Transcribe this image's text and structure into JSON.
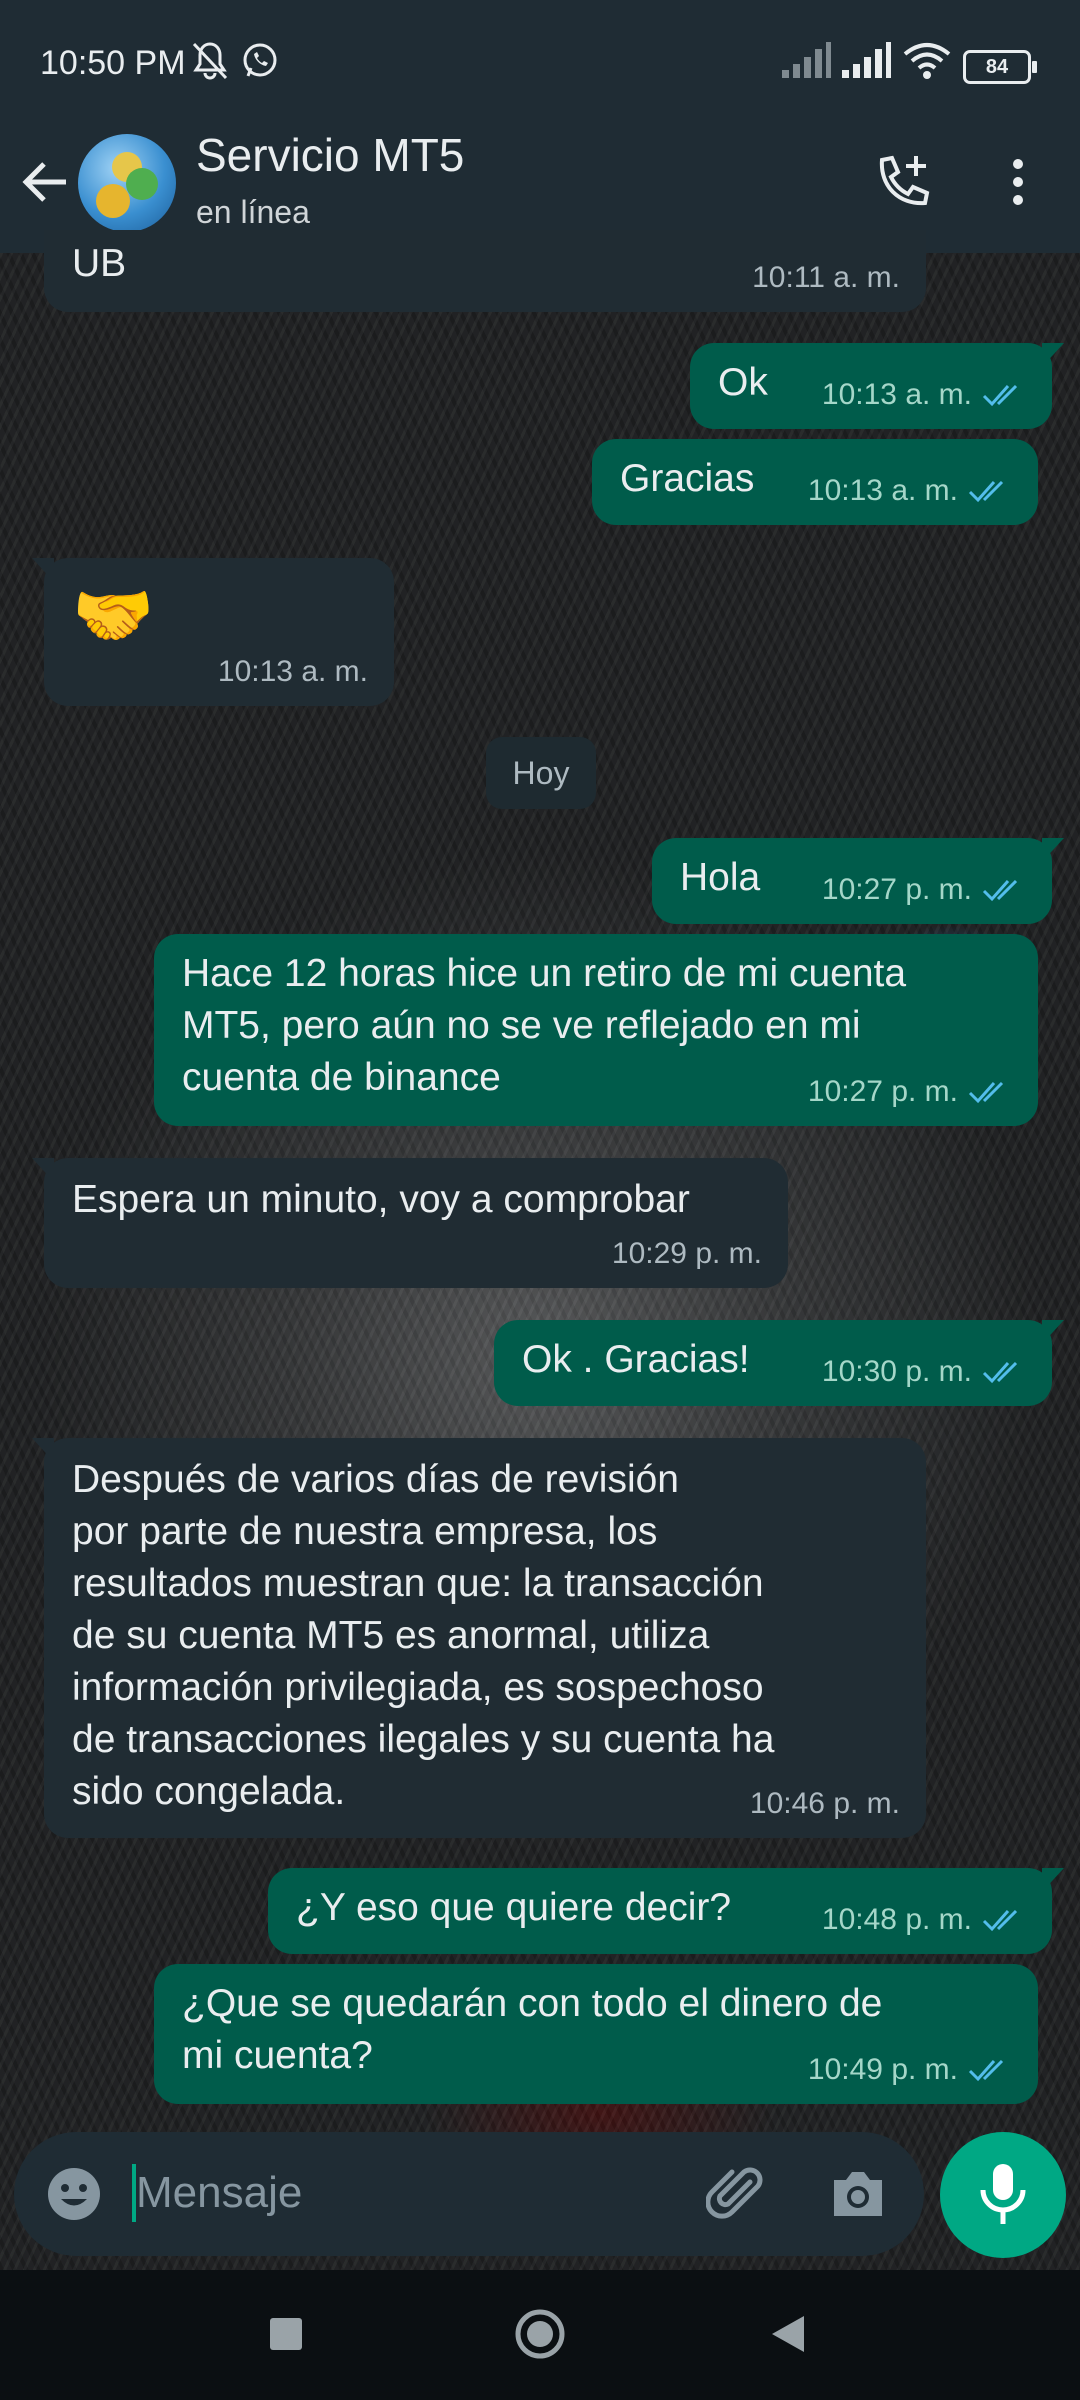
{
  "status_bar": {
    "time": "10:50 PM",
    "battery": "84"
  },
  "header": {
    "contact_name": "Servicio MT5",
    "contact_status": "en línea"
  },
  "messages": [
    {
      "direction": "in",
      "text": "UB",
      "time": "10:11 a. m."
    },
    {
      "direction": "out",
      "text": "Ok",
      "time": "10:13 a. m."
    },
    {
      "direction": "out",
      "text": "Gracias",
      "time": "10:13 a. m."
    },
    {
      "direction": "in",
      "text": "🤝",
      "time": "10:13 a. m."
    },
    {
      "direction": "out",
      "text": "Hola",
      "time": "10:27 p. m."
    },
    {
      "direction": "out",
      "text": "Hace 12 horas hice un retiro de mi cuenta\nMT5, pero aún no se ve reflejado en mi\ncuenta de binance",
      "time": "10:27 p. m."
    },
    {
      "direction": "in",
      "text": "Espera un minuto, voy a comprobar",
      "time": "10:29 p. m."
    },
    {
      "direction": "out",
      "text": "Ok . Gracias!",
      "time": "10:30 p. m."
    },
    {
      "direction": "in",
      "text": "Después de varios días de revisión\npor parte de nuestra empresa, los\nresultados muestran que: la transacción\nde su cuenta MT5 es anormal, utiliza\ninformación privilegiada, es sospechoso\nde transacciones ilegales y su cuenta ha\nsido congelada.",
      "time": "10:46 p. m."
    },
    {
      "direction": "out",
      "text": "¿Y eso que quiere decir?",
      "time": "10:48 p. m."
    },
    {
      "direction": "out",
      "text": "¿Que se quedarán con todo el dinero de\nmi cuenta?",
      "time": "10:49 p. m."
    }
  ],
  "date_separator": "Hoy",
  "composer": {
    "placeholder": "Mensaje"
  },
  "colors": {
    "outgoing_bubble": "#005c4b",
    "incoming_bubble": "#202c33",
    "header": "#1f2c34",
    "accent": "#00a884",
    "read_tick": "#53bdeb"
  },
  "icons": [
    "back-arrow-icon",
    "add-call-icon",
    "more-options-icon",
    "emoji-icon",
    "attach-icon",
    "camera-icon",
    "mic-icon",
    "mute-icon",
    "whatsapp-icon",
    "wifi-icon",
    "signal-icon",
    "battery-icon",
    "nav-square-icon",
    "nav-home-icon",
    "nav-back-icon"
  ]
}
